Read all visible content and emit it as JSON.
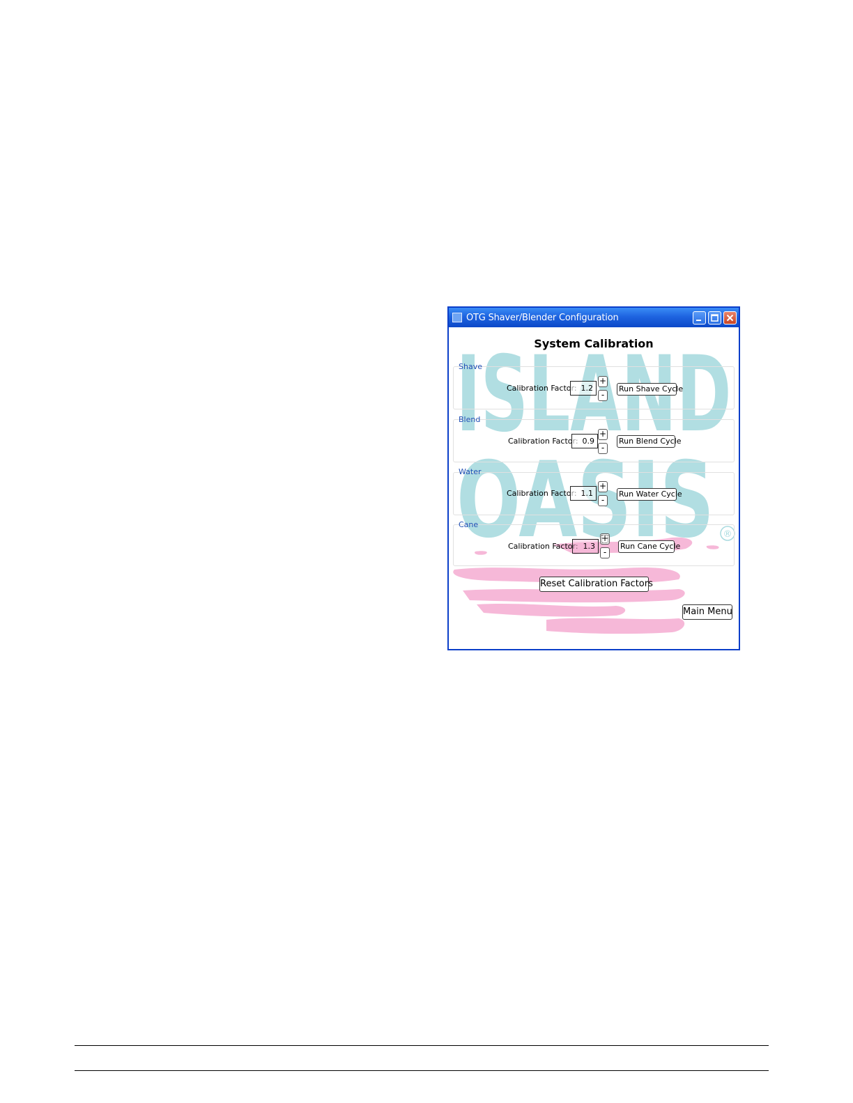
{
  "window": {
    "title": "OTG Shaver/Blender Configuration",
    "controls": [
      "minimize-icon",
      "maximize-icon",
      "close-icon"
    ]
  },
  "heading": "System Calibration",
  "watermark": {
    "line1": "ISLAND",
    "line2": "OASIS",
    "mark": "®",
    "colors": {
      "letters": "#a8dadf",
      "swoosh": "#f6b8d8"
    }
  },
  "groups": [
    {
      "label": "Shave",
      "factor_label": "Calibration Factor:",
      "value": "1.2",
      "plus": "+",
      "minus": "-",
      "run_label": "Run Shave Cycle"
    },
    {
      "label": "Blend",
      "factor_label": "Calibration Factor:",
      "value": "0.9",
      "plus": "+",
      "minus": "-",
      "run_label": "Run Blend Cycle"
    },
    {
      "label": "Water",
      "factor_label": "Calibration Factor:",
      "value": "1.1",
      "plus": "+",
      "minus": "-",
      "run_label": "Run Water Cycle"
    },
    {
      "label": "Cane",
      "factor_label": "Calibration Factor:",
      "value": "1.3",
      "plus": "+",
      "minus": "-",
      "run_label": "Run Cane Cycle"
    }
  ],
  "reset_label": "Reset Calibration Factors",
  "main_menu_label": "Main Menu",
  "colors": {
    "titlebar": "#1e64e0",
    "group_label": "#1f4fb5"
  }
}
